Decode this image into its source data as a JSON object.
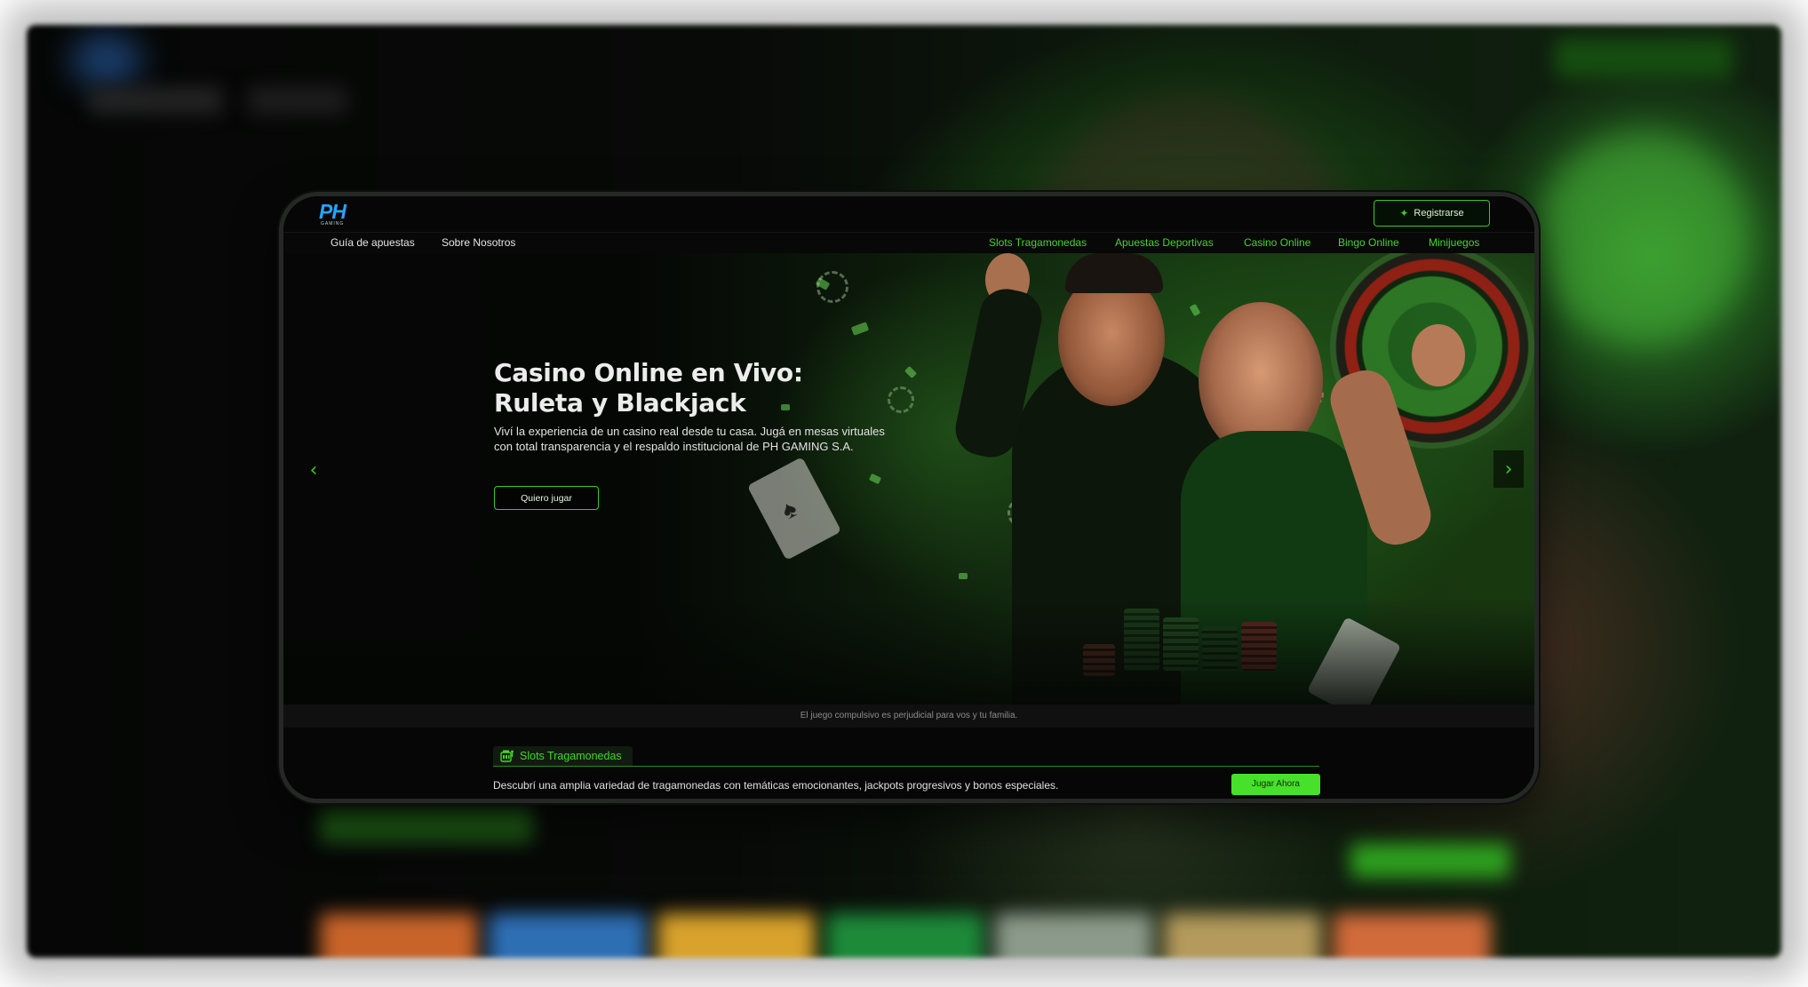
{
  "header": {
    "logo_text": "PH",
    "logo_sub": "GAMING",
    "register_label": "Registrarse"
  },
  "nav": {
    "left": [
      "Guía de apuestas",
      "Sobre Nosotros"
    ],
    "right": [
      "Slots Tragamonedas",
      "Apuestas Deportivas",
      "Casino Online",
      "Bingo Online",
      "Minijuegos"
    ]
  },
  "hero": {
    "title_line1": "Casino Online en Vivo:",
    "title_line2": "Ruleta y Blackjack",
    "desc_line1": "Viví la experiencia de un casino real desde tu casa. Jugá en mesas virtuales",
    "desc_line2": "con total transparencia y el respaldo institucional de PH GAMING S.A.",
    "cta_label": "Quiero jugar",
    "prev_icon": "chevron-left-icon",
    "next_icon": "chevron-right-icon"
  },
  "warning": {
    "text": "El juego compulsivo es perjudicial para vos y tu familia."
  },
  "slots": {
    "tab_label": "Slots Tragamonedas",
    "tab_icon": "slot-machine-icon",
    "description": "Descubrí una amplia variedad de tragamonedas con temáticas emocionantes, jackpots progresivos y bonos especiales.",
    "play_label": "Jugar Ahora"
  },
  "colors": {
    "accent": "#3ec728",
    "logo": "#27a4ff",
    "background": "#040504"
  }
}
